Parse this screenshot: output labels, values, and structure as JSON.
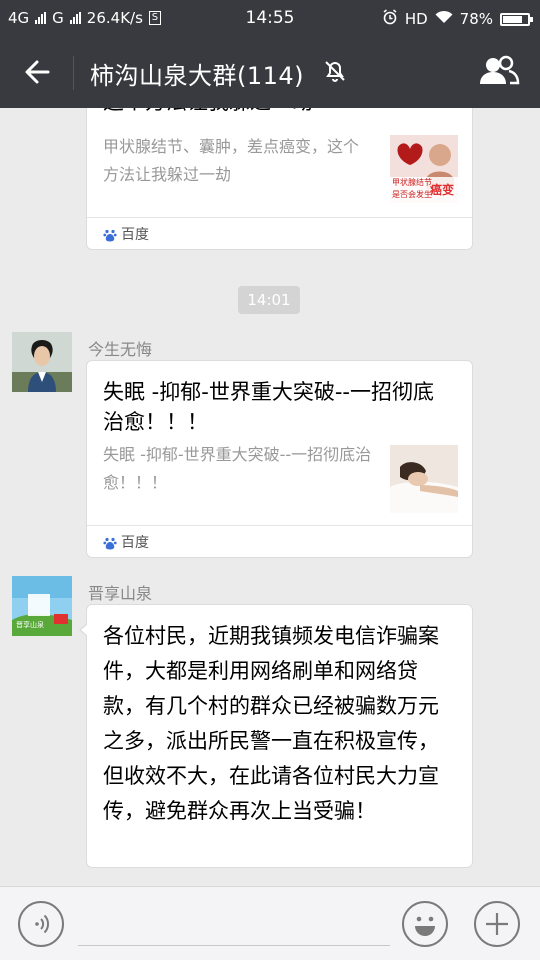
{
  "status_bar": {
    "network_1": "4G",
    "network_2": "G",
    "speed": "26.4K/s",
    "time": "14:55",
    "hd": "HD",
    "battery_percent": "78%",
    "battery_level": 0.78
  },
  "header": {
    "title": "柿沟山泉大群(114)"
  },
  "messages": {
    "card1": {
      "title": "这个方法让我躲过一劫",
      "description": "甲状腺结节、囊肿，差点癌变，这个方法让我躲过一劫",
      "thumb_text_1": "甲状腺结节",
      "thumb_text_2": "是否会发生",
      "thumb_text_3": "癌变",
      "source": "百度"
    },
    "timestamp": "14:01",
    "msg2": {
      "sender": "今生无悔",
      "title": "失眠 -抑郁-世界重大突破--一招彻底治愈！！！",
      "description": "失眠 -抑郁-世界重大突破--一招彻底治愈！！！",
      "source": "百度"
    },
    "msg3": {
      "sender": "晋享山泉",
      "avatar_text": "晋享山泉",
      "text": "各位村民，近期我镇频发电信诈骗案件，大都是利用网络刷单和网络贷款，有几个村的群众已经被骗数万元之多，派出所民警一直在积极宣传，但收效不大，在此请各位村民大力宣传，避免群众再次上当受骗！"
    }
  },
  "colors": {
    "header_bg": "#393a3f",
    "chat_bg": "#ebebeb",
    "accent_red": "#e03030"
  }
}
